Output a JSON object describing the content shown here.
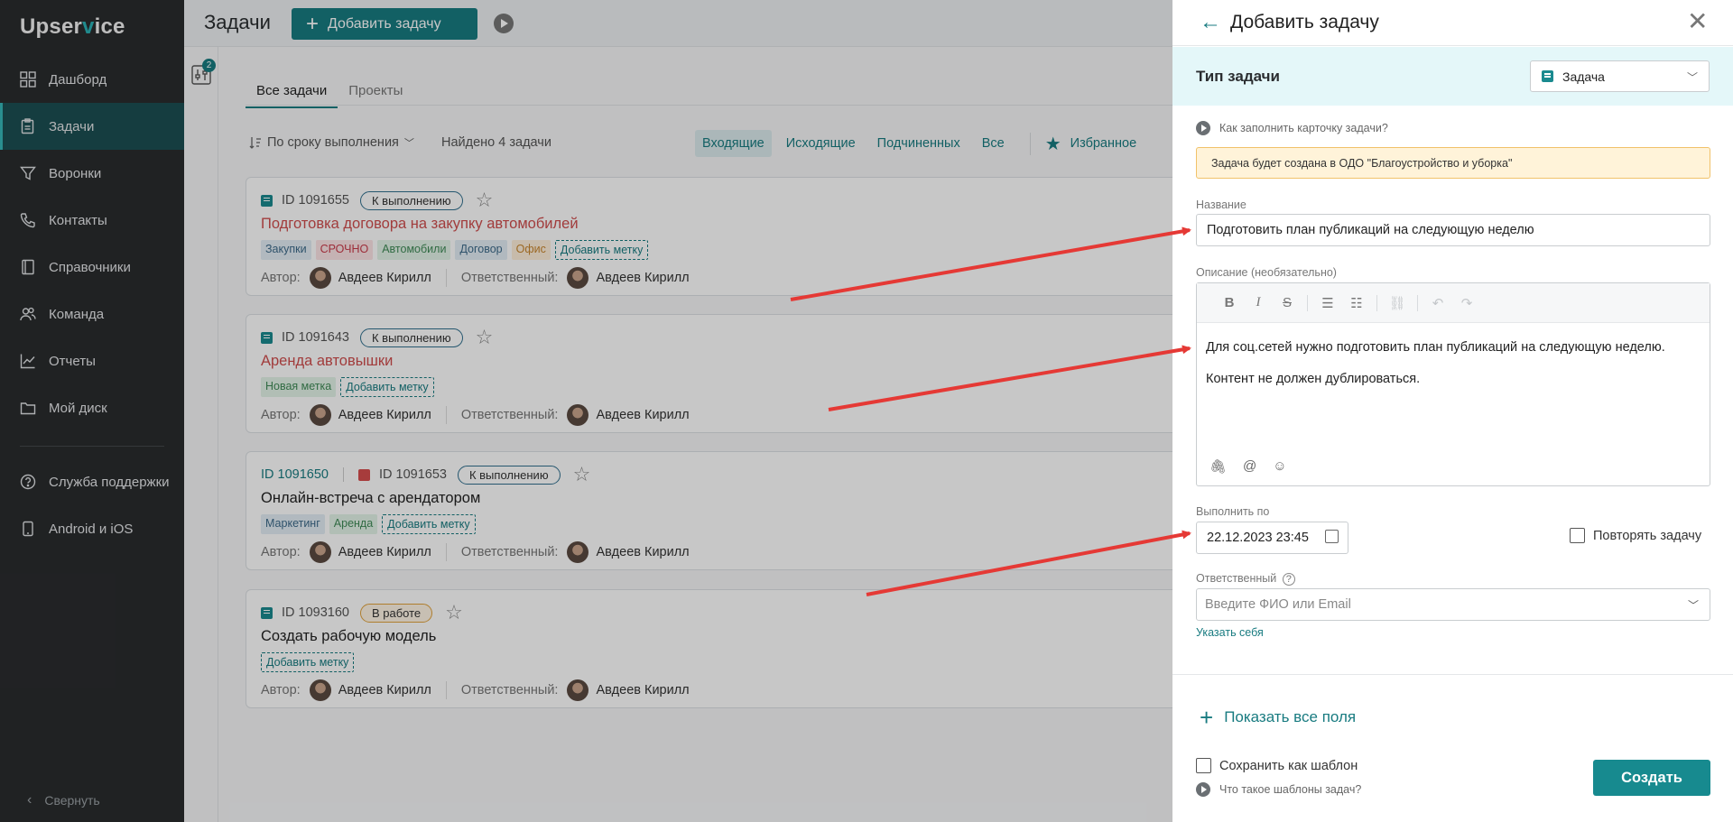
{
  "app": {
    "logo_prefix": "Upser",
    "logo_v": "v",
    "logo_suffix": "ice",
    "colors": {
      "accent": "#187b80",
      "sidebar": "#2a2c2e",
      "danger": "#cf4d4d",
      "annotation_arrow": "#e53935"
    }
  },
  "sidebar": {
    "items": [
      {
        "label": "Дашборд",
        "icon": "dashboard-icon"
      },
      {
        "label": "Задачи",
        "icon": "clipboard-icon",
        "active": true
      },
      {
        "label": "Воронки",
        "icon": "funnel-icon"
      },
      {
        "label": "Контакты",
        "icon": "phone-icon"
      },
      {
        "label": "Справочники",
        "icon": "book-icon"
      },
      {
        "label": "Команда",
        "icon": "team-icon"
      },
      {
        "label": "Отчеты",
        "icon": "chart-icon"
      },
      {
        "label": "Мой диск",
        "icon": "folder-icon"
      },
      {
        "label": "Служба поддержки",
        "icon": "help-icon"
      },
      {
        "label": "Android и iOS",
        "icon": "phone-device-icon"
      }
    ],
    "collapse_label": "Свернуть"
  },
  "header": {
    "title": "Задачи",
    "add_task": "Добавить задачу"
  },
  "filter_badge": "2",
  "tabs": [
    "Все задачи",
    "Проекты"
  ],
  "toolbar": {
    "sort_label": "По сроку выполнения",
    "found": "Найдено 4 задачи",
    "filters": [
      "Входящие",
      "Исходящие",
      "Подчиненных",
      "Все"
    ],
    "favorites": "Избранное"
  },
  "cards": [
    {
      "id": "ID 1091655",
      "status": "К выполнению",
      "title": "Подготовка договора на закупку автомобилей",
      "tags": [
        {
          "label": "Закупки",
          "bg": "#e3eef5",
          "fg": "#3d6a8a"
        },
        {
          "label": "СРОЧНО",
          "bg": "#fde4e6",
          "fg": "#c93a4a"
        },
        {
          "label": "Автомобили",
          "bg": "#e3f4e8",
          "fg": "#3f8a57"
        },
        {
          "label": "Договор",
          "bg": "#e3eef5",
          "fg": "#3d6a8a"
        },
        {
          "label": "Офис",
          "bg": "#fff0dc",
          "fg": "#c8862e"
        }
      ],
      "add_tag": "Добавить метку",
      "author_label": "Автор:",
      "author": "Авдеев Кирилл",
      "resp_label": "Ответственный:",
      "responsible": "Авдеев Кирилл"
    },
    {
      "id": "ID 1091643",
      "status": "К выполнению",
      "title": "Аренда автовышки",
      "tags": [
        {
          "label": "Новая метка",
          "bg": "#e3f4e8",
          "fg": "#3f8a57"
        }
      ],
      "add_tag": "Добавить метку",
      "author_label": "Автор:",
      "author": "Авдеев Кирилл",
      "resp_label": "Ответственный:",
      "responsible": "Авдеев Кирилл"
    },
    {
      "parent_id": "ID 1091650",
      "id": "ID 1091653",
      "status": "К выполнению",
      "title": "Онлайн-встреча с арендатором",
      "tags": [
        {
          "label": "Маркетинг",
          "bg": "#e3eef5",
          "fg": "#3d6a8a"
        },
        {
          "label": "Аренда",
          "bg": "#e3f4e8",
          "fg": "#3f8a57"
        }
      ],
      "add_tag": "Добавить метку",
      "author_label": "Автор:",
      "author": "Авдеев Кирилл",
      "resp_label": "Ответственный:",
      "responsible": "Авдеев Кирилл"
    },
    {
      "id": "ID 1093160",
      "status": "В работе",
      "title": "Создать рабочую модель",
      "tags": [],
      "add_tag": "Добавить метку",
      "author_label": "Автор:",
      "author": "Авдеев Кирилл",
      "resp_label": "Ответственный:",
      "responsible": "Авдеев Кирилл"
    }
  ],
  "panel": {
    "title": "Добавить задачу",
    "type_label": "Тип задачи",
    "type_value": "Задача",
    "howto": "Как заполнить карточку задачи?",
    "notice_prefix": "Задача будет создана в ",
    "notice_org": "ОДО \"Благоустройство и уборка\"",
    "name_label": "Название",
    "name_value": "Подготовить план публикаций на следующую неделю",
    "desc_label": "Описание (необязательно)",
    "desc_p1": "Для соц.сетей нужно подготовить план публикаций на следующую неделю.",
    "desc_p2": "Контент не должен дублироваться.",
    "due_label": "Выполнить по",
    "due_value": "22.12.2023 23:45",
    "repeat_label": "Повторять задачу",
    "resp_label": "Ответственный",
    "resp_placeholder": "Введите ФИО или Email",
    "self_link": "Указать себя",
    "show_all": "Показать все поля",
    "save_template": "Сохранить как шаблон",
    "what_template": "Что такое шаблоны задач?",
    "create": "Создать"
  }
}
